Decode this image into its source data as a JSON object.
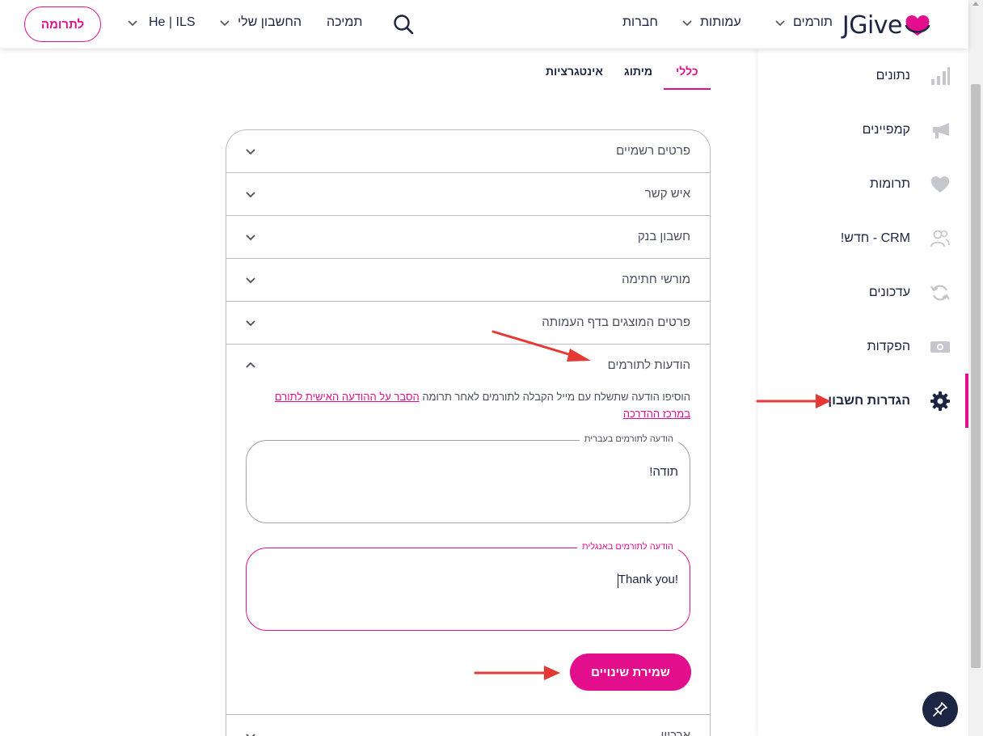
{
  "header": {
    "logo_text": "JGive",
    "nav": {
      "donors": "תורמים",
      "nonprofits": "עמותות",
      "companies": "חברות",
      "support": "תמיכה",
      "my_account": "החשבון שלי",
      "lang_currency": "He | ILS"
    },
    "donate_button": "לתרומה"
  },
  "sidebar": {
    "items": [
      {
        "label": "נתונים",
        "icon": "bar-chart-icon"
      },
      {
        "label": "קמפיינים",
        "icon": "megaphone-icon"
      },
      {
        "label": "תרומות",
        "icon": "heart-icon"
      },
      {
        "label": "CRM - חדש!",
        "icon": "users-icon"
      },
      {
        "label": "עדכונים",
        "icon": "refresh-icon"
      },
      {
        "label": "הפקדות",
        "icon": "cash-icon"
      },
      {
        "label": "הגדרות חשבון",
        "icon": "gear-icon",
        "active": true
      }
    ]
  },
  "tabs": {
    "general": "כללי",
    "branding": "מיתוג",
    "integrations": "אינטגרציות",
    "active": "general"
  },
  "accordion": {
    "sections": [
      "פרטים רשמיים",
      "איש קשר",
      "חשבון בנק",
      "מורשי חתימה",
      "פרטים המוצגים בדף העמותה"
    ],
    "open_section": {
      "title": "הודעות לתורמים",
      "note_text": "הוסיפו הודעה שתשלח עם מייל הקבלה לתורמים לאחר תרומה ",
      "note_link": "הסבר על ההודעה האישית לתורם במרכז ההדרכה",
      "hebrew_field": {
        "label": "הודעה לתורמים בעברית",
        "value": "תודה!"
      },
      "english_field": {
        "label": "הודעה לתורמים באנגלית",
        "value": "Thank you!"
      },
      "save_button": "שמירת שינויים"
    },
    "next_section": "ארכיון"
  },
  "colors": {
    "brand_pink": "#e20e8c",
    "navy": "#1c2541",
    "annotation_red": "#e53935"
  }
}
